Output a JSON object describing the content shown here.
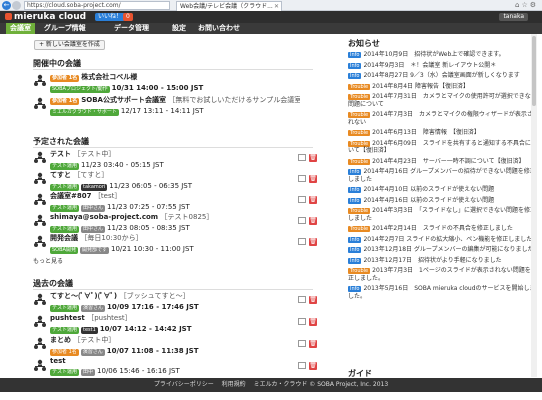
{
  "browser": {
    "url": "https://cloud.soba-project.com/",
    "tab_title": "Web会議/テレビ会議（クラウド...",
    "back_glyph": "←"
  },
  "app": {
    "logo": "mieruka cloud",
    "like_label": "いいね！",
    "new_label": "0",
    "user": "tanaka"
  },
  "nav": {
    "items": [
      "会議室",
      "グループ情報",
      "データ管理",
      "設定",
      "お問い合わせ"
    ]
  },
  "actions": {
    "new_meeting": "+ 新しい会議室を作成"
  },
  "sections": {
    "ongoing": "開催中の会議",
    "scheduled": "予定された会議",
    "past": "過去の会議",
    "more": "もっと見る"
  },
  "ongoing": [
    {
      "title": "株式会社コベル様",
      "sub": "",
      "b1": "参加者 1名",
      "b2": "SOBAプロジェクト/動作",
      "time": "10/31 14:00 - 15:00 JST"
    },
    {
      "title": "SOBA公式サポート会議室",
      "sub": "［無料でお試しいただけるサンプル会議室です］",
      "b1": "参加者 1名",
      "b2": "ミエルカクラウド・サポート",
      "time": "12/17 13:11 - 14:11 JST"
    }
  ],
  "scheduled": [
    {
      "title": "テスト",
      "sub": "［テスト中］",
      "b1": "テスト運用",
      "time": "11/23 03:40 - 05:15 JST"
    },
    {
      "title": "てすと",
      "sub": "［てすと］",
      "b1": "テスト運用",
      "b2": "takamori",
      "time": "11/23 06:05 - 06:35 JST"
    },
    {
      "title": "会議室#807",
      "sub": "［test］",
      "b1": "テスト運用",
      "b2": "田中さん",
      "time": "11/23 07:25 - 07:55 JST"
    },
    {
      "title": "shimaya@soba-project.com",
      "sub": "［テスト0825］",
      "b1": "テスト運用",
      "b2": "田中さん",
      "time": "11/23 08:05 - 08:35 JST"
    },
    {
      "title": "開発会議",
      "sub": "［毎日10:30から］",
      "b1": "SOBA開発",
      "b2": "開発部です",
      "time": "10/21 10:30 - 11:00 JST"
    }
  ],
  "past": [
    {
      "title": "てすと～(ﾟ∀ﾟ)(ﾟ∀ﾟ)",
      "sub": "［ブッシュてすと～］",
      "b1": "テスト運用",
      "b2": "演習さん",
      "time": "10/09 17:16 - 17:46 JST"
    },
    {
      "title": "pushtest",
      "sub": "［pushtest］",
      "b1": "テスト運用",
      "b2": "test1",
      "time": "10/07 14:12 - 14:42 JST"
    },
    {
      "title": "まとめ",
      "sub": "［テスト中］",
      "b1": "参加者 1名",
      "b2": "演習さん",
      "time": "10/07 11:08 - 11:38 JST"
    },
    {
      "title": "test",
      "sub": "",
      "b1": "テスト運用",
      "b2": "田中",
      "time": "10/06 15:46 - 16:16 JST"
    }
  ],
  "news": {
    "title": "お知らせ",
    "items": [
      {
        "badge": "Info",
        "text": "2014年10月9日　招待状がWeb上で確認できます。"
      },
      {
        "badge": "Info",
        "text": "2014年9月3日　＊！会議室 新レイアウト公開＊"
      },
      {
        "badge": "Info",
        "text": "2014年8月27日 9／3（水）会議室画面が新しくなります"
      },
      {
        "badge": "Trouble",
        "text": "2014年8月4日 障害報告【復旧済】"
      },
      {
        "badge": "Trouble",
        "text": "2014年7月31日　カメラとマイクの使用許可が選択できない問題について"
      },
      {
        "badge": "Trouble",
        "text": "2014年7月3日　カメラとマイクの権限ウィザードが表示されない"
      },
      {
        "badge": "Trouble",
        "text": "2014年6月13日　障害情報　【復旧済】"
      },
      {
        "badge": "Trouble",
        "text": "2014年6月09日　スライドを共有すると通知する不具合について【復旧済】"
      },
      {
        "badge": "Trouble",
        "text": "2014年4月23日　サーバー一時不調について【復旧済】"
      },
      {
        "badge": "Info",
        "text": "2014年4月16日 グループメンバーの招待ができない問題を修正しました"
      },
      {
        "badge": "Info",
        "text": "2014年4月10日 以前のスライドが使えない問題"
      },
      {
        "badge": "Info",
        "text": "2014年4月16日 以前のスライドが使えない問題"
      },
      {
        "badge": "Trouble",
        "text": "2014年3月3日　「スライドなし」に選択できない問題を修正しました"
      },
      {
        "badge": "Trouble",
        "text": "2014年2月14日　スライドの不具合を修正しました"
      },
      {
        "badge": "Info",
        "text": "2014年2月7日 スライドの拡大縮小、ペン機能を修正しました"
      },
      {
        "badge": "Info",
        "text": "2013年12月18日 グループメンバーの編集が可能になりました"
      },
      {
        "badge": "Info",
        "text": "2013年12月17日　招待状がより手軽になりました"
      },
      {
        "badge": "Trouble",
        "text": "2013年7月3日　1ページのスライドが表示されない問題を修正しました。"
      },
      {
        "badge": "Info",
        "text": "2013年5月16日　SOBA mieruka cloudのサービスを開始しました。"
      }
    ]
  },
  "guide": {
    "title": "ガイド"
  },
  "footer": {
    "privacy": "プライバシーポリシー",
    "terms": "利用規約",
    "copyright": "ミエルカ・クラウド © SOBA Project, Inc. 2013"
  }
}
